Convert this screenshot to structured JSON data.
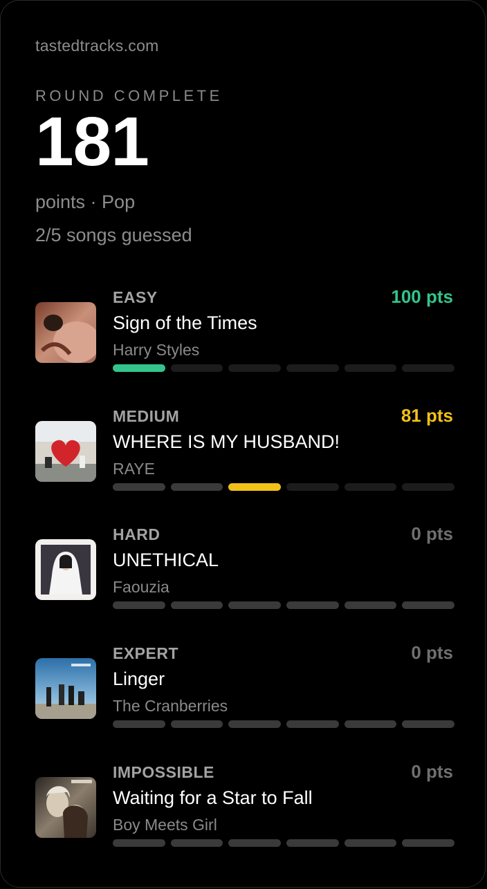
{
  "site": "tastedtracks.com",
  "round_label": "ROUND COMPLETE",
  "score": "181",
  "meta_line": "points · Pop",
  "guessed_line": "2/5 songs guessed",
  "colors": {
    "green": "#33c48c",
    "yellow": "#f2c119",
    "grey_pts": "#6f6f6f",
    "seg_default": "#3a3a3a",
    "seg_dark": "#1c1c1c"
  },
  "songs": [
    {
      "difficulty": "EASY",
      "points": "100 pts",
      "points_color": "#33c48c",
      "title": "Sign of the Times",
      "artist": "Harry Styles",
      "cover_icon": "album-cover-harry-styles",
      "segments": [
        "#33c48c",
        "#1c1c1c",
        "#1c1c1c",
        "#1c1c1c",
        "#1c1c1c",
        "#1c1c1c"
      ]
    },
    {
      "difficulty": "MEDIUM",
      "points": "81 pts",
      "points_color": "#f2c119",
      "title": "WHERE IS MY HUSBAND!",
      "artist": "RAYE",
      "cover_icon": "album-cover-raye",
      "segments": [
        "#3a3a3a",
        "#3a3a3a",
        "#f2c119",
        "#1c1c1c",
        "#1c1c1c",
        "#1c1c1c"
      ]
    },
    {
      "difficulty": "HARD",
      "points": "0 pts",
      "points_color": "#6f6f6f",
      "title": "UNETHICAL",
      "artist": "Faouzia",
      "cover_icon": "album-cover-faouzia",
      "segments": [
        "#3a3a3a",
        "#3a3a3a",
        "#3a3a3a",
        "#3a3a3a",
        "#3a3a3a",
        "#3a3a3a"
      ]
    },
    {
      "difficulty": "EXPERT",
      "points": "0 pts",
      "points_color": "#6f6f6f",
      "title": "Linger",
      "artist": "The Cranberries",
      "cover_icon": "album-cover-cranberries",
      "segments": [
        "#3a3a3a",
        "#3a3a3a",
        "#3a3a3a",
        "#3a3a3a",
        "#3a3a3a",
        "#3a3a3a"
      ]
    },
    {
      "difficulty": "IMPOSSIBLE",
      "points": "0 pts",
      "points_color": "#6f6f6f",
      "title": "Waiting for a Star to Fall",
      "artist": "Boy Meets Girl",
      "cover_icon": "album-cover-boy-meets-girl",
      "segments": [
        "#3a3a3a",
        "#3a3a3a",
        "#3a3a3a",
        "#3a3a3a",
        "#3a3a3a",
        "#3a3a3a"
      ]
    }
  ]
}
